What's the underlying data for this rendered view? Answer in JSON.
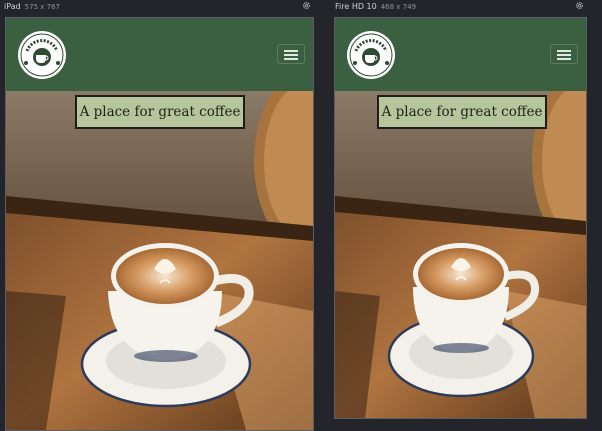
{
  "devices": [
    {
      "name": "iPad",
      "size": "575 x 767"
    },
    {
      "name": "Fire HD 10",
      "size": "468 x 749"
    }
  ],
  "hero_heading": "A place for great coffee",
  "colors": {
    "background": "#23252a",
    "navbar": "#3b6041",
    "heading_box": "#b5c69d",
    "heading_border": "#1d1d1d"
  },
  "icons": [
    "settings-gear-icon",
    "coffee-cup-logo-icon",
    "hamburger-menu-icon"
  ]
}
